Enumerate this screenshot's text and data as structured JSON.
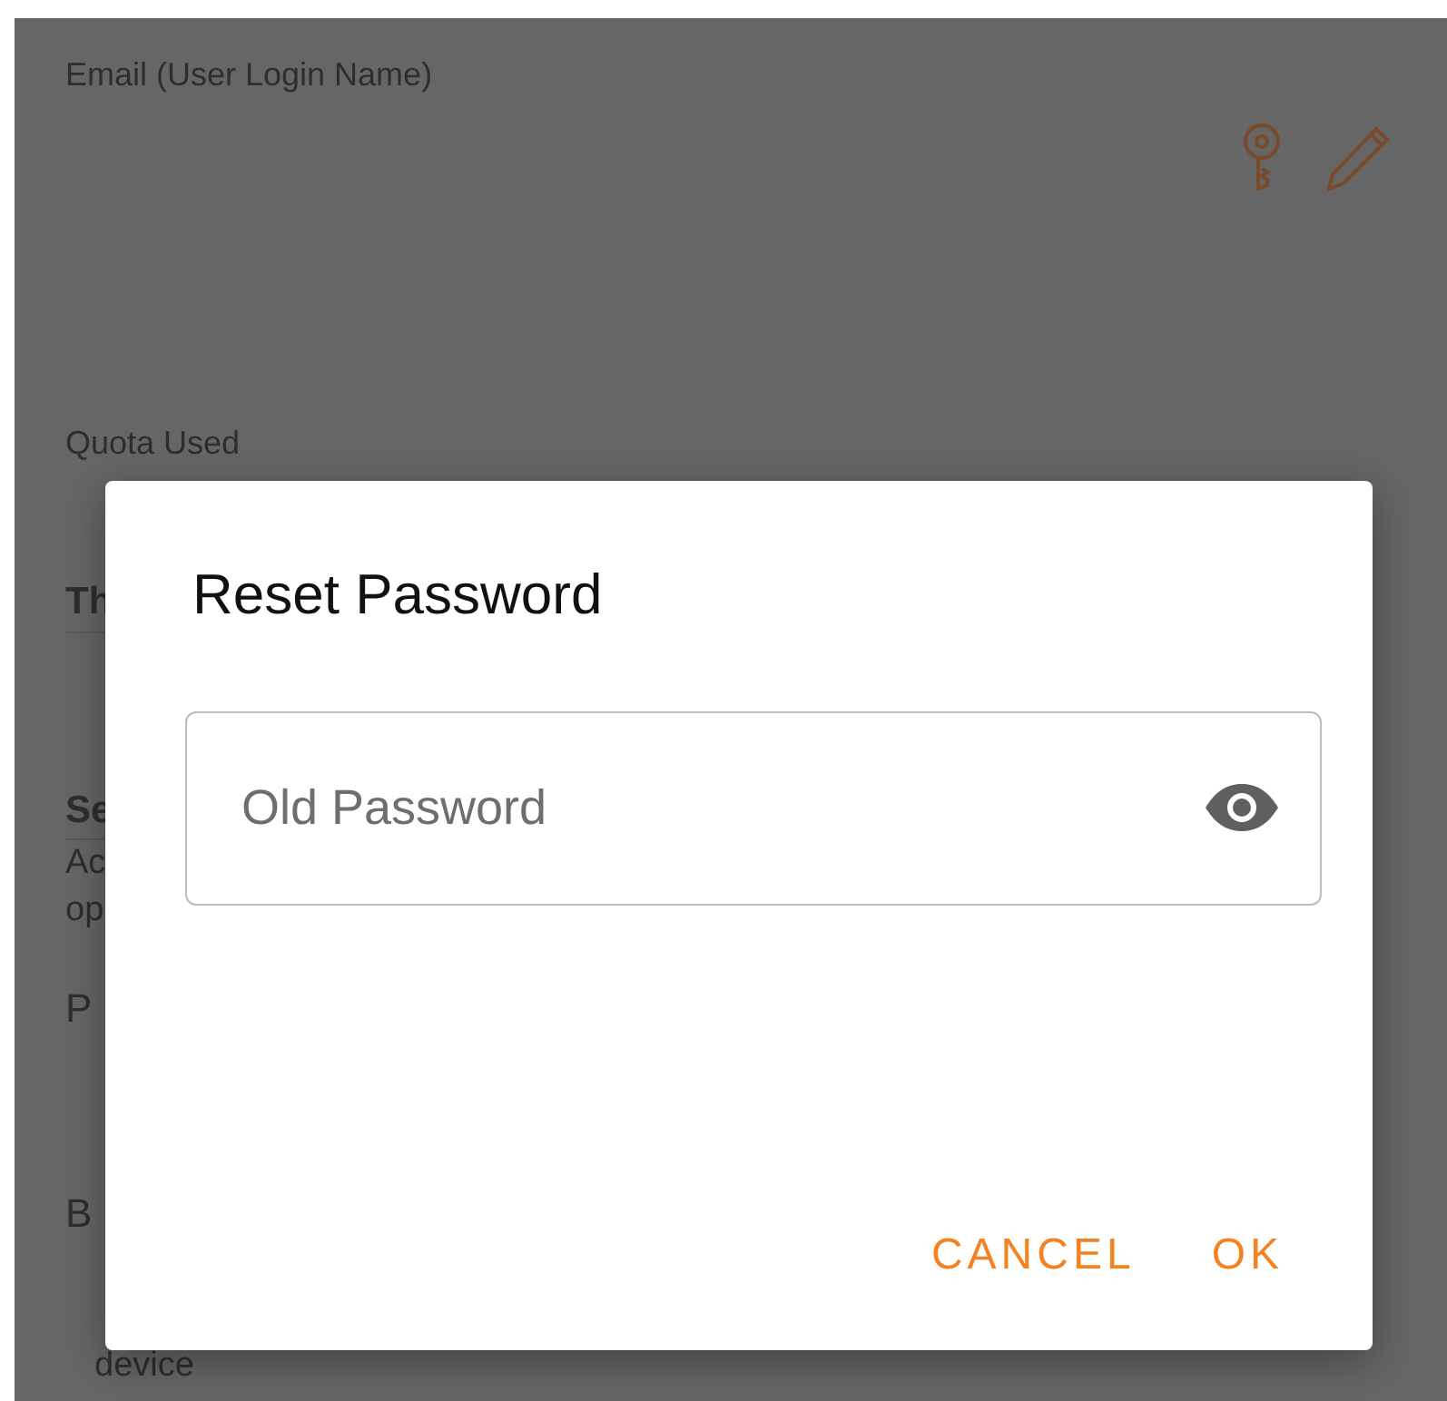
{
  "background": {
    "email_label": "Email (User Login Name)",
    "quota_label": "Quota Used",
    "fragments": [
      {
        "text": "Th",
        "kind": "heading"
      },
      {
        "text": "Se",
        "kind": "heading"
      },
      {
        "text": "Ac",
        "kind": "note"
      },
      {
        "text": "op",
        "kind": "note"
      },
      {
        "text": "P",
        "kind": "row"
      },
      {
        "text": "B",
        "kind": "row"
      },
      {
        "text": "device",
        "kind": "tail"
      }
    ]
  },
  "dialog": {
    "title": "Reset Password",
    "field": {
      "placeholder": "Old Password"
    },
    "buttons": [
      "CANCEL",
      "OK"
    ]
  }
}
